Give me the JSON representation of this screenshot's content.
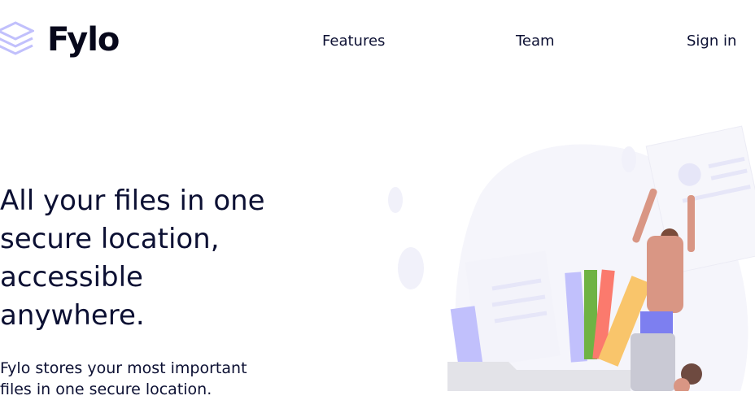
{
  "brand": {
    "name": "Fylo",
    "logo_icon": "stacked-layers-icon",
    "accent": "#c1c0fc"
  },
  "nav": {
    "features": "Features",
    "team": "Team",
    "signin": "Sign in"
  },
  "hero": {
    "title": "All your files in one secure location, accessible anywhere.",
    "description": "Fylo stores your most important files in one secure location.",
    "illustration_icon": "hero-illustration"
  },
  "colors": {
    "text": "#0c1033",
    "background": "#ffffff"
  }
}
